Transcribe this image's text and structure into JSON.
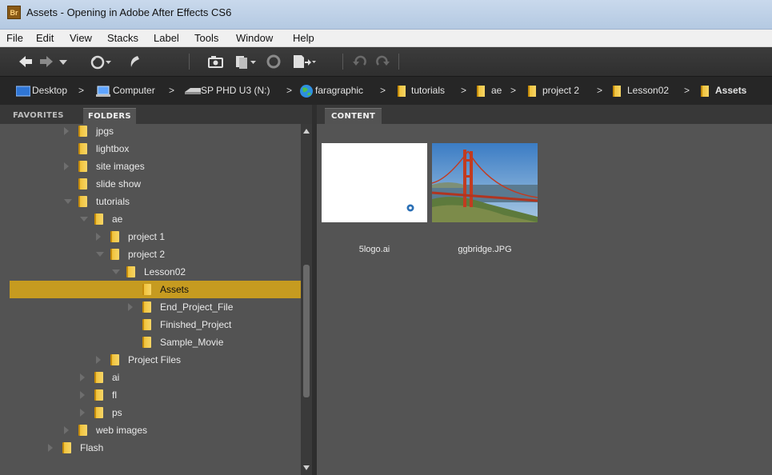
{
  "window": {
    "app_badge": "Br",
    "title": "Assets - Opening in Adobe After Effects CS6"
  },
  "menu": [
    "File",
    "Edit",
    "View",
    "Stacks",
    "Label",
    "Tools",
    "Window",
    "Help"
  ],
  "toolbar": {
    "icons": [
      "back-arrow-icon",
      "forward-arrow-icon",
      "dropdown-chevron-icon",
      "recent-folder-icon",
      "boomerang-icon",
      "camera-import-icon",
      "review-icon",
      "refine-icon",
      "open-with-icon",
      "rotate-left-icon",
      "rotate-right-icon"
    ]
  },
  "breadcrumb": {
    "items": [
      {
        "label": "Desktop",
        "icon": "desktop-icon"
      },
      {
        "label": "Computer",
        "icon": "computer-icon"
      },
      {
        "label": "SP PHD U3 (N:)",
        "icon": "drive-icon"
      },
      {
        "label": "faragraphic",
        "icon": "network-globe-icon"
      },
      {
        "label": "tutorials",
        "icon": "folder-icon"
      },
      {
        "label": "ae",
        "icon": "folder-icon"
      },
      {
        "label": "project 2",
        "icon": "folder-icon"
      },
      {
        "label": "Lesson02",
        "icon": "folder-icon"
      },
      {
        "label": "Assets",
        "icon": "folder-icon",
        "current": true
      }
    ],
    "separator": ">"
  },
  "left_panel": {
    "tabs": [
      {
        "label": "FAVORITES",
        "active": false
      },
      {
        "label": "FOLDERS",
        "active": true
      }
    ],
    "tree": [
      {
        "label": "jpgs",
        "depth": 0,
        "expander": "closed"
      },
      {
        "label": "lightbox",
        "depth": 0,
        "expander": "none"
      },
      {
        "label": "site images",
        "depth": 0,
        "expander": "closed"
      },
      {
        "label": "slide show",
        "depth": 0,
        "expander": "none"
      },
      {
        "label": "tutorials",
        "depth": 0,
        "expander": "open"
      },
      {
        "label": "ae",
        "depth": 1,
        "expander": "open"
      },
      {
        "label": "project 1",
        "depth": 2,
        "expander": "closed"
      },
      {
        "label": "project 2",
        "depth": 2,
        "expander": "open"
      },
      {
        "label": "Lesson02",
        "depth": 3,
        "expander": "open"
      },
      {
        "label": "Assets",
        "depth": 4,
        "expander": "none",
        "selected": true
      },
      {
        "label": "End_Project_File",
        "depth": 4,
        "expander": "closed"
      },
      {
        "label": "Finished_Project",
        "depth": 4,
        "expander": "none"
      },
      {
        "label": "Sample_Movie",
        "depth": 4,
        "expander": "none"
      },
      {
        "label": "Project Files",
        "depth": 2,
        "expander": "closed"
      },
      {
        "label": "ai",
        "depth": 1,
        "expander": "closed"
      },
      {
        "label": "fl",
        "depth": 1,
        "expander": "closed"
      },
      {
        "label": "ps",
        "depth": 1,
        "expander": "closed"
      },
      {
        "label": "web images",
        "depth": 0,
        "expander": "closed"
      },
      {
        "label": "Flash",
        "depth": -1,
        "expander": "closed"
      }
    ],
    "selected_color": "#c69b20"
  },
  "content_panel": {
    "tab_label": "CONTENT",
    "items": [
      {
        "filename": "5logo.ai",
        "thumb": "white-logo-thumbnail"
      },
      {
        "filename": "ggbridge.JPG",
        "thumb": "golden-gate-bridge-photo"
      }
    ]
  },
  "colors": {
    "accent": "#c69b20",
    "panel": "#535353",
    "path_bar": "#262626"
  }
}
